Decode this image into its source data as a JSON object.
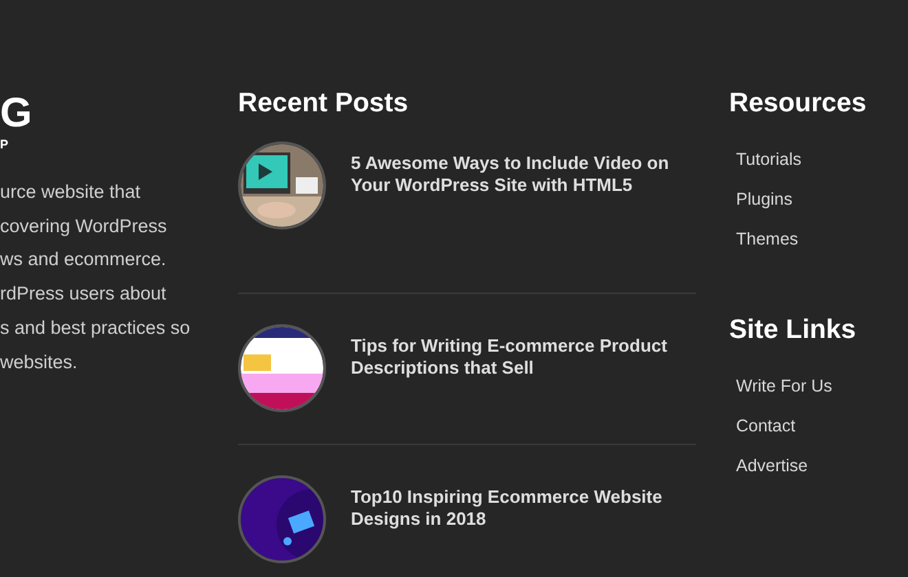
{
  "about": {
    "logo_mark": "G",
    "logo_tagline": "P",
    "lines": [
      "urce website that",
      "covering WordPress",
      "ws and ecommerce.",
      "rdPress users about",
      "s and best practices so",
      "websites."
    ]
  },
  "recent_posts": {
    "heading": "Recent Posts",
    "posts": [
      {
        "title": "5 Awesome Ways to Include Video on Your WordPress Site with HTML5",
        "kind": "picture"
      },
      {
        "title": "Tips for Writing E-commerce Product Descriptions that Sell",
        "kind": "picture"
      },
      {
        "title": "Top10 Inspiring Ecommerce Website Designs in 2018",
        "kind": "picture"
      }
    ]
  },
  "resources": {
    "heading": "Resources",
    "links": [
      "Tutorials",
      "Plugins",
      "Themes"
    ]
  },
  "site_links": {
    "heading": "Site Links",
    "links": [
      "Write For Us",
      "Contact",
      "Advertise"
    ]
  }
}
